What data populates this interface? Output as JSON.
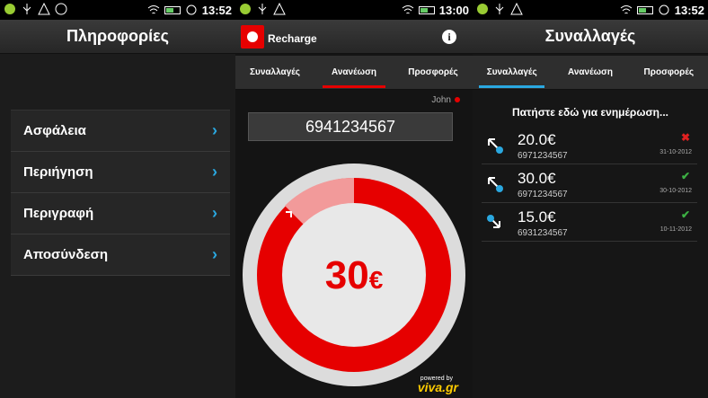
{
  "status_times": [
    "13:52",
    "13:00",
    "13:52"
  ],
  "panel1": {
    "title": "Πληροφορίες",
    "menu": [
      {
        "label": "Ασφάλεια"
      },
      {
        "label": "Περιήγηση"
      },
      {
        "label": "Περιγραφή"
      },
      {
        "label": "Αποσύνδεση"
      }
    ]
  },
  "panel2": {
    "app_label": "Recharge",
    "tabs": [
      "Συναλλαγές",
      "Ανανέωση",
      "Προσφορές"
    ],
    "user": "John",
    "phone": "6941234567",
    "amount": "30",
    "currency": "€",
    "powered_by": "powered by",
    "brand": "viva.gr"
  },
  "panel3": {
    "title": "Συναλλαγές",
    "tabs": [
      "Συναλλαγές",
      "Ανανέωση",
      "Προσφορές"
    ],
    "refresh_text": "Πατήστε εδώ για ενημέρωση...",
    "transactions": [
      {
        "amount": "20.0€",
        "number": "6971234567",
        "date": "31-10-2012",
        "status": "failed"
      },
      {
        "amount": "30.0€",
        "number": "6971234567",
        "date": "30-10-2012",
        "status": "ok"
      },
      {
        "amount": "15.0€",
        "number": "6931234567",
        "date": "10-11-2012",
        "status": "ok"
      }
    ]
  },
  "colors": {
    "vodafone_red": "#e60000",
    "accent_blue": "#2aa8e0",
    "ok_green": "#3cb043"
  }
}
